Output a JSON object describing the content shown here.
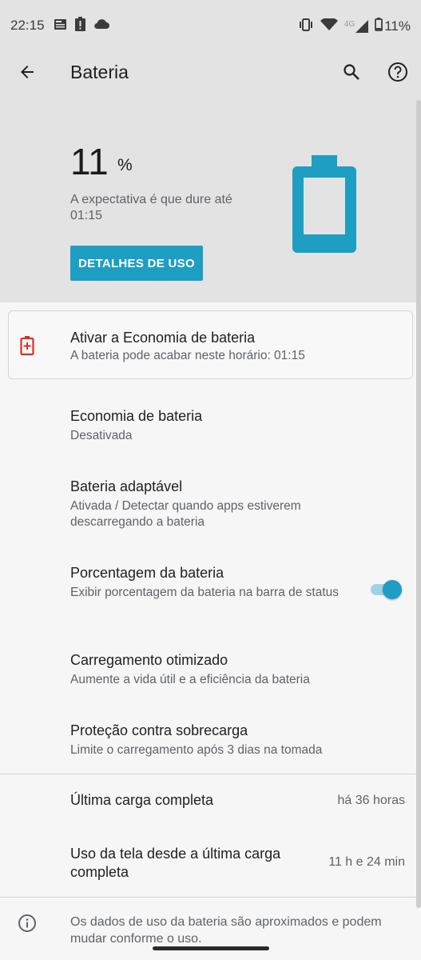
{
  "status_bar": {
    "time": "22:15",
    "left_icons": [
      "news-icon",
      "alert-icon",
      "cloud-icon"
    ],
    "right_icons": [
      "vibrate-icon",
      "wifi-icon",
      "signal-4g-icon",
      "battery-icon"
    ],
    "network_label": "4G",
    "battery_text": "11%"
  },
  "app_bar": {
    "title": "Bateria",
    "back_icon": "arrow-back-icon",
    "search_icon": "search-icon",
    "help_icon": "help-icon"
  },
  "summary": {
    "percent_value": "11",
    "percent_sign": "%",
    "estimate": "A expectativa é que dure até 01:15",
    "details_button": "DETALHES DE USO",
    "accent_color": "#1e9ec2",
    "battery_level": 0.11
  },
  "saver_suggestion": {
    "title": "Ativar a Economia de bateria",
    "subtitle": "A bateria pode acabar neste horário: 01:15",
    "icon": "battery-plus-icon",
    "icon_color": "#d93025"
  },
  "settings": [
    {
      "title": "Economia de bateria",
      "subtitle": "Desativada"
    },
    {
      "title": "Bateria adaptável",
      "subtitle": "Ativada / Detectar quando apps estiverem descarregando a bateria"
    },
    {
      "title": "Porcentagem da bateria",
      "subtitle": "Exibir porcentagem da bateria na barra de status",
      "toggle": true
    },
    {
      "title": "Carregamento otimizado",
      "subtitle": "Aumente a vida útil e a eficiência da bateria"
    },
    {
      "title": "Proteção contra sobrecarga",
      "subtitle": "Limite o carregamento após 3 dias na tomada"
    }
  ],
  "usage": [
    {
      "label": "Última carga completa",
      "value": "há 36 horas"
    },
    {
      "label": "Uso da tela desde a última carga completa",
      "value": "11 h e 24 min"
    }
  ],
  "footer_info": "Os dados de uso da bateria são aproximados e podem mudar conforme o uso."
}
